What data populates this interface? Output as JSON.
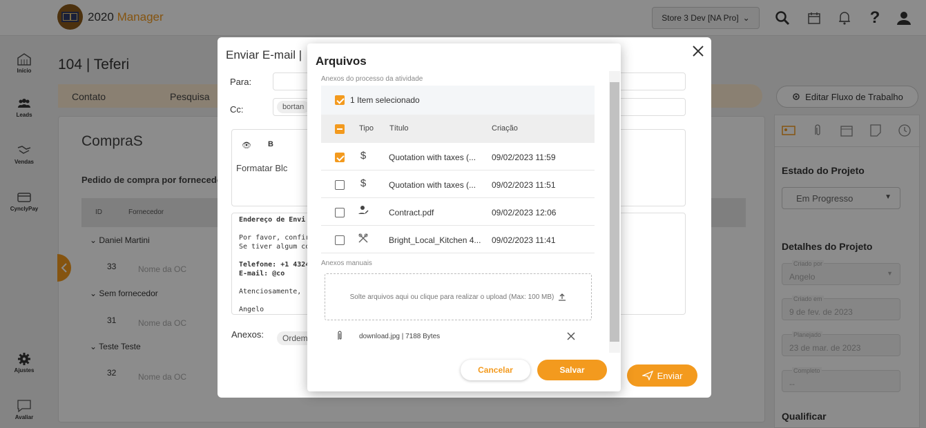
{
  "app": {
    "name_part1": "2020",
    "name_part2": "Manager"
  },
  "header": {
    "store": "Store 3 Dev [NA Pro]"
  },
  "sidebar": {
    "items": [
      {
        "label": "Início"
      },
      {
        "label": "Leads"
      },
      {
        "label": "Vendas"
      },
      {
        "label": "CynclyPay"
      },
      {
        "label": "Ajustes"
      },
      {
        "label": "Avaliar"
      }
    ]
  },
  "page": {
    "title": "104 | Teferi",
    "tabs": [
      "Contato",
      "Pesquisa"
    ],
    "workflow_button": "Editar Fluxo de Trabalho"
  },
  "main": {
    "title": "CompraS",
    "subtitle": "Pedido de compra por fornecedo",
    "columns": [
      "ID",
      "Fornecedor"
    ],
    "groups": [
      {
        "name": "Daniel Martini",
        "id": "33",
        "placeholder": "Nome da OC"
      },
      {
        "name": "Sem fornecedor",
        "id": "31",
        "placeholder": "Nome da OC"
      },
      {
        "name": "Teste Teste",
        "id": "32",
        "placeholder": "Nome da OC"
      }
    ]
  },
  "right_panel": {
    "state_heading": "Estado do Projeto",
    "state_value": "Em Progresso",
    "details_heading": "Detalhes do Projeto",
    "created_by_label": "Criado por",
    "created_by_value": "Angelo",
    "created_on_label": "Criado em",
    "created_on_value": "9 de fev. de 2023",
    "planned_label": "Planejado",
    "planned_value": "23 de mar. de 2023",
    "complete_label": "Completo",
    "complete_value": "--",
    "qualify_heading": "Qualificar"
  },
  "email_dialog": {
    "title": "Enviar E-mail  |",
    "to_label": "Para:",
    "cc_label": "Cc:",
    "cc_chip": "bortan",
    "format_block": "Formatar Blc",
    "body_lines": [
      "Endereço de Envi",
      "",
      "Por favor, confirme",
      "Se tiver algum com",
      "",
      "Telefone: +1 4324",
      "E-mail:      @co",
      "",
      "Atenciosamente,",
      "",
      "Angelo"
    ],
    "attachments_label": "Anexos:",
    "attachment_chip": "Ordem",
    "send_label": "Enviar"
  },
  "files_dialog": {
    "title": "Arquivos",
    "process_section": "Anexos do processo da atividade",
    "selected_text": "1 Item selecionado",
    "columns": {
      "type": "Tipo",
      "title": "Título",
      "created": "Criação"
    },
    "rows": [
      {
        "checked": true,
        "icon": "dollar-icon",
        "glyph": "$",
        "title": "Quotation with taxes (...",
        "date": "09/02/2023 11:59"
      },
      {
        "checked": false,
        "icon": "dollar-icon",
        "glyph": "$",
        "title": "Quotation with taxes (...",
        "date": "09/02/2023 11:51"
      },
      {
        "checked": false,
        "icon": "contract-icon",
        "glyph": "",
        "title": "Contract.pdf",
        "date": "09/02/2023 12:06"
      },
      {
        "checked": false,
        "icon": "design-tools-icon",
        "glyph": "",
        "title": "Bright_Local_Kitchen 4...",
        "date": "09/02/2023 11:41"
      }
    ],
    "manual_section": "Anexos manuais",
    "dropzone_text": "Solte arquivos aqui ou clique para realizar o upload (Max: 100 MB)",
    "attachment_file": "download.jpg | 7188 Bytes",
    "cancel_label": "Cancelar",
    "save_label": "Salvar"
  },
  "colors": {
    "accent": "#f39a1e",
    "accent_light": "#fbe9cf"
  }
}
